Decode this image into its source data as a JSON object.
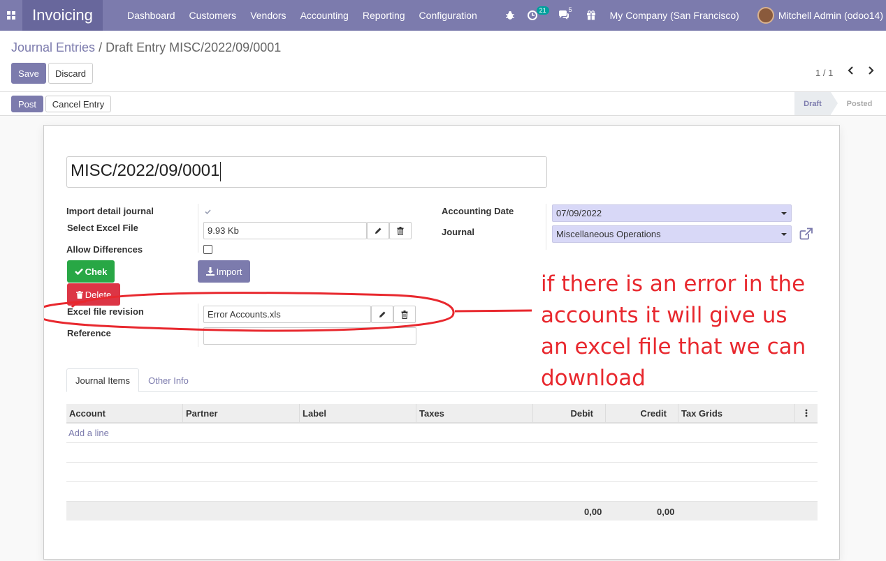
{
  "navbar": {
    "app_name": "Invoicing",
    "menu": [
      "Dashboard",
      "Customers",
      "Vendors",
      "Accounting",
      "Reporting",
      "Configuration"
    ],
    "activity_count": "21",
    "message_count": "5",
    "company": "My Company (San Francisco)",
    "user": "Mitchell Admin (odoo14)"
  },
  "breadcrumb": {
    "parent": "Journal Entries",
    "separator": "/",
    "current": "Draft Entry MISC/2022/09/0001"
  },
  "buttons": {
    "save": "Save",
    "discard": "Discard",
    "post": "Post",
    "cancel_entry": "Cancel Entry",
    "chek": "Chek",
    "import": "Import",
    "delete": "Delete"
  },
  "pager": {
    "value": "1 / 1"
  },
  "status": {
    "draft": "Draft",
    "posted": "Posted"
  },
  "form": {
    "name": "MISC/2022/09/0001",
    "import_detail_journal_label": "Import detail journal",
    "import_detail_journal_checked": true,
    "select_excel_file_label": "Select Excel File",
    "select_excel_file_value": "9.93 Kb",
    "allow_differences_label": "Allow Differences",
    "allow_differences_checked": false,
    "excel_file_revision_label": "Excel file revision",
    "excel_file_revision_value": "Error Accounts.xls",
    "reference_label": "Reference",
    "reference_value": "",
    "accounting_date_label": "Accounting Date",
    "accounting_date_value": "07/09/2022",
    "journal_label": "Journal",
    "journal_value": "Miscellaneous Operations"
  },
  "annotation": {
    "text": "if there is an error in the accounts it will give us an excel file that we can download",
    "color": "#e8282e"
  },
  "tabs": [
    "Journal Items",
    "Other Info"
  ],
  "table": {
    "columns": [
      "Account",
      "Partner",
      "Label",
      "Taxes",
      "Debit",
      "Credit",
      "Tax Grids"
    ],
    "add_line": "Add a line",
    "total_debit": "0,00",
    "total_credit": "0,00"
  },
  "colors": {
    "brand": "#7c7bad",
    "success": "#28a745",
    "danger": "#dc3545",
    "select_bg": "#d8d8f7"
  }
}
